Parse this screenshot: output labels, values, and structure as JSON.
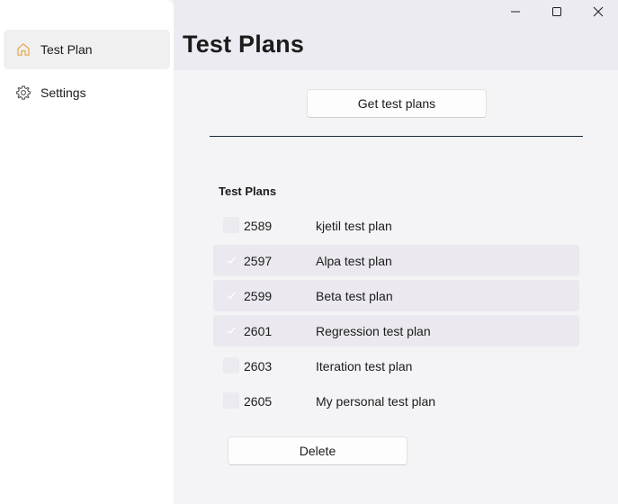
{
  "sidebar": {
    "items": [
      {
        "label": "Test Plan",
        "icon": "home-icon",
        "selected": true
      },
      {
        "label": "Settings",
        "icon": "gear-icon",
        "selected": false
      }
    ]
  },
  "window": {
    "caption_buttons": [
      "minimize-icon",
      "maximize-icon",
      "close-icon"
    ]
  },
  "main": {
    "title": "Test Plans",
    "get_button_label": "Get test plans",
    "list_header": "Test Plans",
    "rows": [
      {
        "id": "2589",
        "name": "kjetil test plan",
        "selected": false
      },
      {
        "id": "2597",
        "name": "Alpa test plan",
        "selected": true
      },
      {
        "id": "2599",
        "name": "Beta test plan",
        "selected": true
      },
      {
        "id": "2601",
        "name": "Regression test plan",
        "selected": true
      },
      {
        "id": "2603",
        "name": "Iteration test plan",
        "selected": false
      },
      {
        "id": "2605",
        "name": "My personal test plan",
        "selected": false
      }
    ],
    "delete_button_label": "Delete"
  },
  "colors": {
    "accent": "#e6a84a",
    "sidebar_bg": "#ffffff",
    "main_bg": "#f4f3f6",
    "selected_row_bg": "#ebe9ef",
    "divider": "#1b2a3a"
  }
}
